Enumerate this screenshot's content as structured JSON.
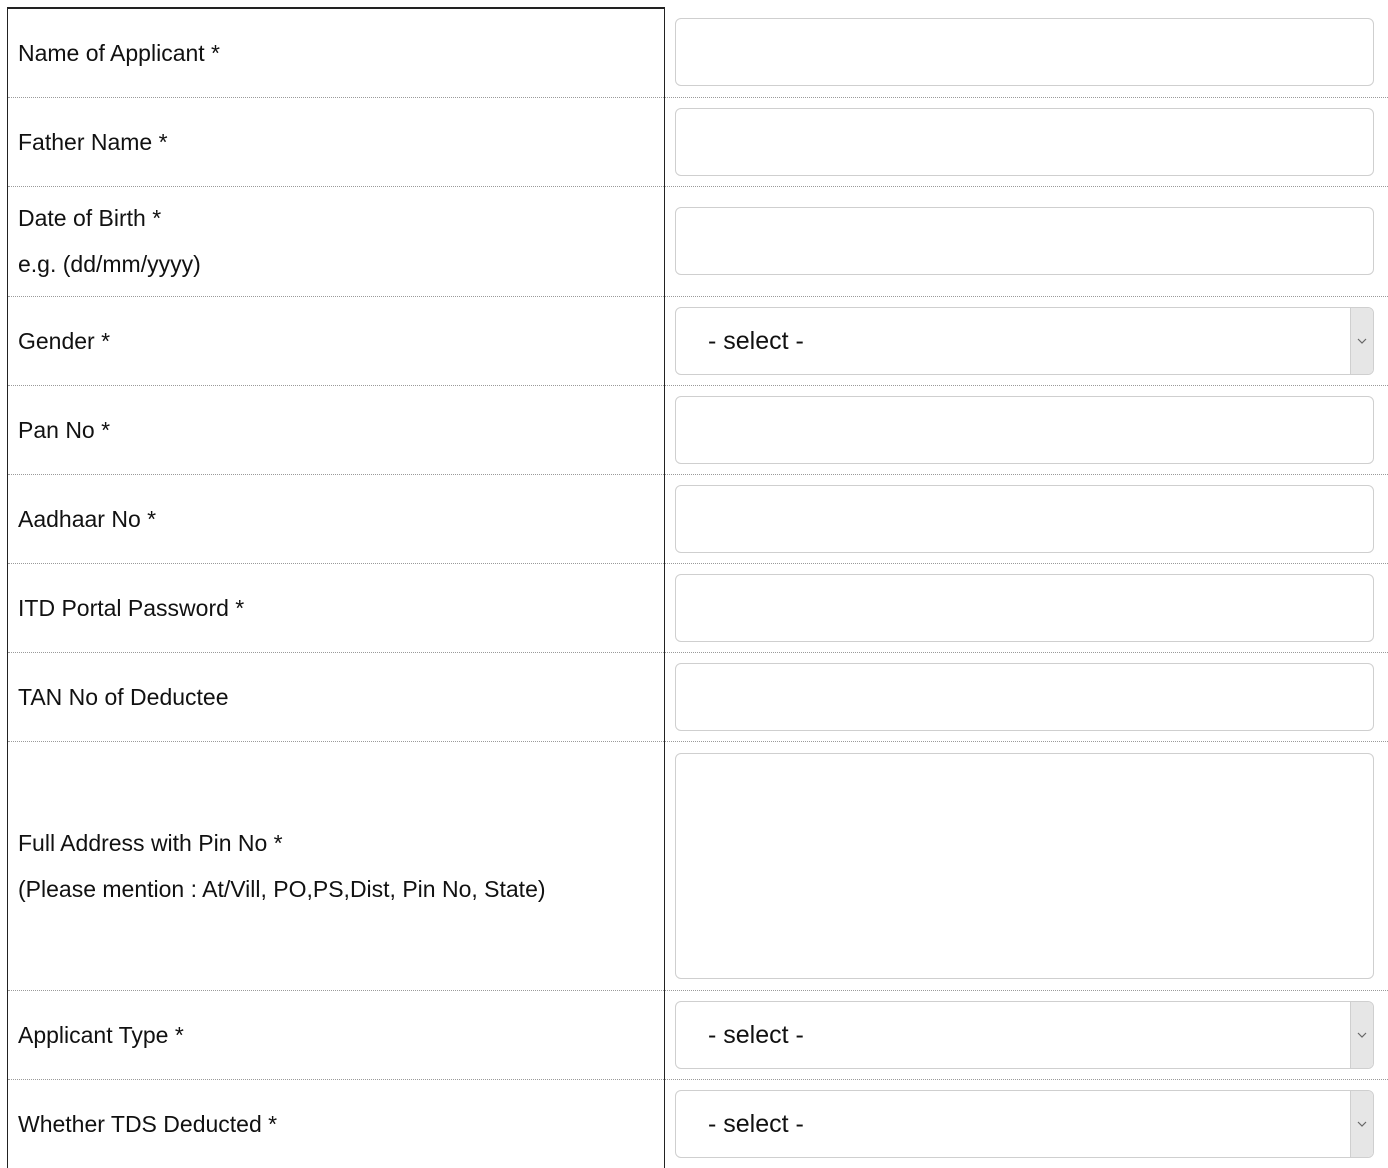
{
  "form": {
    "rows": [
      {
        "label": "Name of Applicant *"
      },
      {
        "label": "Father Name *"
      },
      {
        "label": "Date of Birth *",
        "hint": "e.g. (dd/mm/yyyy)"
      },
      {
        "label": "Gender *",
        "selected": "- select -"
      },
      {
        "label": "Pan No *"
      },
      {
        "label": "Aadhaar No *"
      },
      {
        "label": "ITD Portal Password *"
      },
      {
        "label": "TAN No of Deductee"
      },
      {
        "label": "Full Address with Pin No *",
        "hint": "(Please mention : At/Vill, PO,PS,Dist, Pin No, State)"
      },
      {
        "label": "Applicant Type *",
        "selected": "- select -"
      },
      {
        "label": "Whether TDS Deducted *",
        "selected": "- select -"
      }
    ]
  },
  "icons": {
    "dropdown": "chevron-down-icon"
  },
  "colors": {
    "border": "#cfcfcf",
    "divider": "#9a9a9a",
    "select_arrow_bg": "#e6e6e6"
  }
}
